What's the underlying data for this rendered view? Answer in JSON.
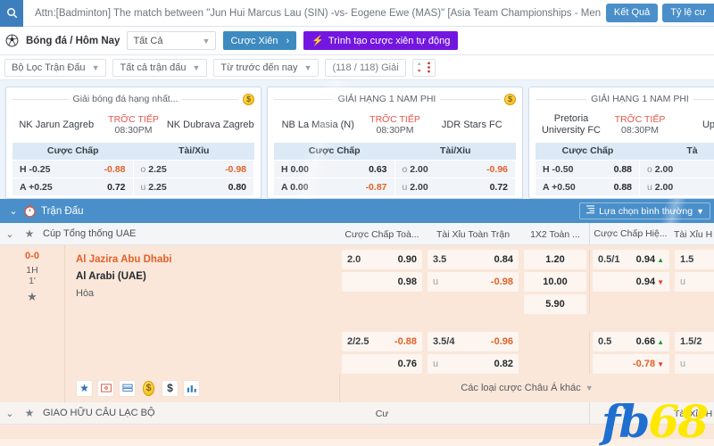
{
  "topbar": {
    "search_icon": "search-icon",
    "marquee": "Attn:[Badminton] The match between \"Jun Hui Marcus Lau (SIN) -vs- Eogene Ewe (MAS)\" [Asia Team Championships - Men",
    "buttons": [
      {
        "label": "Kết Quả"
      },
      {
        "label": "Tỷ lệ cư"
      }
    ]
  },
  "navbar": {
    "icon": "soccer-ball-icon",
    "title": "Bóng đá / Hôm Nay",
    "select_value": "Tất Cả",
    "parlay_button": "Cược Xiên",
    "parlay_arrow": "›",
    "auto_parlay_button": "Trình tạo cược xiên tự động",
    "auto_parlay_icon": "lightning-icon"
  },
  "filterbar": {
    "items": [
      {
        "label": "Bộ Lọc Trận Đấu",
        "has_chevron": true
      },
      {
        "label": "Tất cả trận đấu",
        "has_chevron": true
      },
      {
        "label": "Từ trước đến nay",
        "has_chevron": true
      },
      {
        "label": "(118 / 118) Giải",
        "has_chevron": false
      }
    ],
    "sort_icon": "sort-updown-icon"
  },
  "carousel": {
    "cards": [
      {
        "league": "Giải bóng đá hạng nhất...",
        "coin_icon": "coin-dollar-icon",
        "home": "NK Jarun Zagreb",
        "away": "NK Dubrava Zagreb",
        "live_label": "TRỠC TIẾP",
        "time": "08:30PM",
        "head_left": "Cược Chấp",
        "head_right": "Tài/Xỉu",
        "rows": [
          {
            "lk": "H",
            "lv_key": "-0.25",
            "lval": "-0.88",
            "lneg": true,
            "rk": "o",
            "rv_key": "2.25",
            "rval": "-0.98",
            "rneg": true
          },
          {
            "lk": "A",
            "lv_key": "+0.25",
            "lval": "0.72",
            "lneg": false,
            "rk": "u",
            "rv_key": "2.25",
            "rval": "0.80",
            "rneg": false
          }
        ]
      },
      {
        "league": "GIẢI HẠNG 1 NAM PHI",
        "coin_icon": "coin-dollar-icon",
        "home": "NB La Masia (N)",
        "away": "JDR Stars FC",
        "live_label": "TRỠC TIẾP",
        "time": "08:30PM",
        "head_left": "Cược Chấp",
        "head_right": "Tài/Xỉu",
        "rows": [
          {
            "lk": "H",
            "lv_key": "0.00",
            "lval": "0.63",
            "lneg": false,
            "rk": "o",
            "rv_key": "2.00",
            "rval": "-0.96",
            "rneg": true
          },
          {
            "lk": "A",
            "lv_key": "0.00",
            "lval": "-0.87",
            "lneg": true,
            "rk": "u",
            "rv_key": "2.00",
            "rval": "0.72",
            "rneg": false
          }
        ]
      },
      {
        "league": "GIẢI HẠNG 1 NAM PHI",
        "coin_icon": "coin-dollar-icon",
        "home": "Pretoria University FC",
        "away": "Up",
        "live_label": "TRỠC TIẾP",
        "time": "08:30PM",
        "head_left": "Cược Chấp",
        "head_right": "Tà",
        "rows": [
          {
            "lk": "H",
            "lv_key": "-0.50",
            "lval": "0.88",
            "lneg": false,
            "rk": "o",
            "rv_key": "2.00",
            "rval": "",
            "rneg": false
          },
          {
            "lk": "A",
            "lv_key": "+0.50",
            "lval": "0.88",
            "lneg": false,
            "rk": "u",
            "rv_key": "2.00",
            "rval": "",
            "rneg": false
          }
        ]
      }
    ]
  },
  "section": {
    "caret": "⌄",
    "clock_icon": "stopwatch-icon",
    "title": "Trận Đấu",
    "normal_select": "Lựa chọn bình thường",
    "normal_select_icon": "sort-lines-icon"
  },
  "league_header": {
    "caret": "⌄",
    "star_icon": "star-icon",
    "name": "Cúp Tổng thống UAE",
    "columns": [
      "Cược Chấp Toà...",
      "Tài Xỉu Toàn Trận",
      "1X2 Toàn ...",
      "Cược Chấp Hiệ...",
      "Tài Xỉu H"
    ]
  },
  "match": {
    "score": "0-0",
    "half": "1H",
    "minute": "1'",
    "star_icon": "star-icon",
    "team_home": "Al Jazira Abu Dhabi",
    "team_away": "Al Arabi (UAE)",
    "draw_label": "Hòa",
    "fulltime": {
      "handicap": [
        {
          "key": "2.0",
          "val": "0.90",
          "neg": false
        },
        {
          "key": "",
          "val": "0.98",
          "neg": false
        }
      ],
      "overunder": [
        {
          "key": "3.5",
          "val": "0.84",
          "neg": false,
          "low": false
        },
        {
          "key": "u",
          "val": "-0.98",
          "neg": true,
          "low": true
        }
      ],
      "onextwo": [
        {
          "val": "1.20"
        },
        {
          "val": "10.00"
        },
        {
          "val": "5.90"
        }
      ]
    },
    "halftime": {
      "handicap": [
        {
          "key": "0.5/1",
          "val": "0.94",
          "neg": false,
          "arrow": "up"
        },
        {
          "key": "",
          "val": "0.94",
          "neg": false,
          "arrow": "down"
        }
      ],
      "overunder": [
        {
          "key": "1.5",
          "val": "",
          "neg": false,
          "low": false
        },
        {
          "key": "u",
          "val": "",
          "neg": false,
          "low": true
        }
      ]
    },
    "fulltime2": {
      "handicap": [
        {
          "key": "2/2.5",
          "val": "-0.88",
          "neg": true
        },
        {
          "key": "",
          "val": "0.76",
          "neg": false
        }
      ],
      "overunder": [
        {
          "key": "3.5/4",
          "val": "-0.96",
          "neg": true,
          "low": false
        },
        {
          "key": "u",
          "val": "0.82",
          "neg": false,
          "low": true
        }
      ]
    },
    "halftime2": {
      "handicap": [
        {
          "key": "0.5",
          "val": "0.66",
          "neg": false,
          "arrow": "up"
        },
        {
          "key": "",
          "val": "-0.78",
          "neg": true,
          "arrow": "down"
        }
      ],
      "overunder": [
        {
          "key": "1.5/2",
          "val": "",
          "neg": false,
          "low": false
        },
        {
          "key": "u",
          "val": "",
          "neg": false,
          "low": true
        }
      ]
    },
    "toolbar_icons": [
      "star-icon",
      "field-icon",
      "stats-bars-icon",
      "coin-dollar-icon",
      "dollar-icon",
      "chart-bars-icon"
    ],
    "other_bets_label": "Các loại cược Châu Á khác"
  },
  "league_header2": {
    "caret": "⌄",
    "star_icon": "star-icon",
    "name": "GIAO HỮU CÂU LẠC BỘ",
    "columns": [
      "Cư",
      "Tài Xỉu H"
    ]
  },
  "watermark": {
    "part1": "fb",
    "part2": "68"
  },
  "colors": {
    "blue": "#4a8fc9",
    "purple": "#7317e0",
    "orange": "#e2612a",
    "row_bg": "#fae7da",
    "carousel_bg": "#eef4fb"
  }
}
